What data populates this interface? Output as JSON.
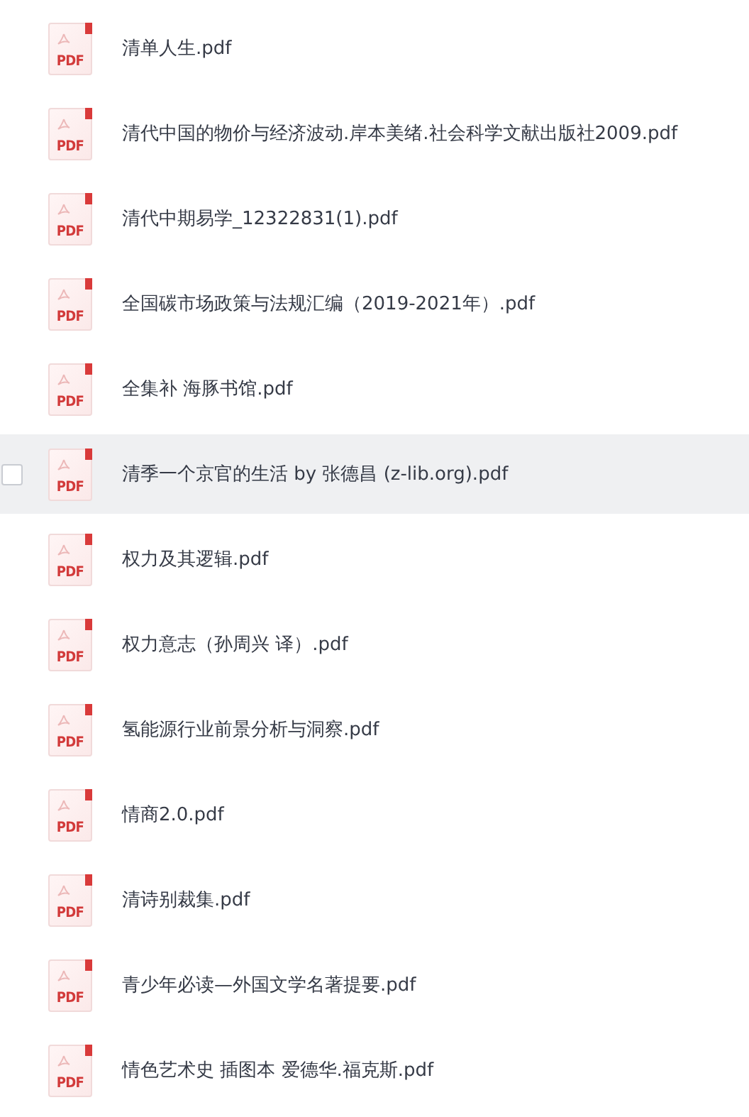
{
  "files": [
    {
      "name": "清单人生.pdf",
      "icon_label": "PDF",
      "hovered": false,
      "checked": false
    },
    {
      "name": "清代中国的物价与经济波动.岸本美绪.社会科学文献出版社2009.pdf",
      "icon_label": "PDF",
      "hovered": false,
      "checked": false
    },
    {
      "name": "清代中期易学_12322831(1).pdf",
      "icon_label": "PDF",
      "hovered": false,
      "checked": false
    },
    {
      "name": "全国碳市场政策与法规汇编（2019-2021年）.pdf",
      "icon_label": "PDF",
      "hovered": false,
      "checked": false
    },
    {
      "name": "全集补  海豚书馆.pdf",
      "icon_label": "PDF",
      "hovered": false,
      "checked": false
    },
    {
      "name": "清季一个京官的生活 by 张德昌 (z-lib.org).pdf",
      "icon_label": "PDF",
      "hovered": true,
      "checked": false
    },
    {
      "name": "权力及其逻辑.pdf",
      "icon_label": "PDF",
      "hovered": false,
      "checked": false
    },
    {
      "name": "权力意志（孙周兴 译）.pdf",
      "icon_label": "PDF",
      "hovered": false,
      "checked": false
    },
    {
      "name": "氢能源行业前景分析与洞察.pdf",
      "icon_label": "PDF",
      "hovered": false,
      "checked": false
    },
    {
      "name": "情商2.0.pdf",
      "icon_label": "PDF",
      "hovered": false,
      "checked": false
    },
    {
      "name": "清诗别裁集.pdf",
      "icon_label": "PDF",
      "hovered": false,
      "checked": false
    },
    {
      "name": "青少年必读—外国文学名著提要.pdf",
      "icon_label": "PDF",
      "hovered": false,
      "checked": false
    },
    {
      "name": "情色艺术史 插图本 爱德华.福克斯.pdf",
      "icon_label": "PDF",
      "hovered": false,
      "checked": false
    }
  ]
}
